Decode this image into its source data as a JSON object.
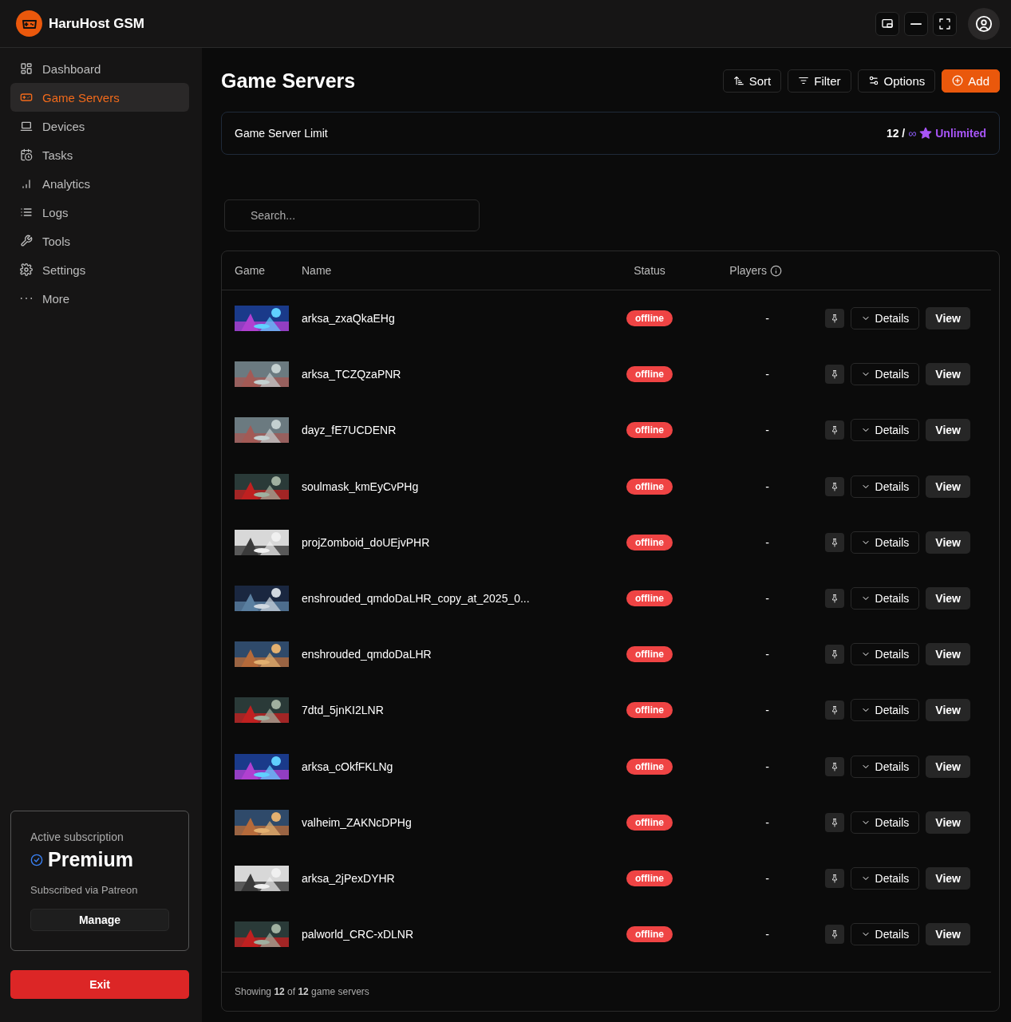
{
  "app": {
    "title": "HaruHost GSM"
  },
  "sidebar": {
    "items": [
      {
        "label": "Dashboard",
        "selected": false
      },
      {
        "label": "Game Servers",
        "selected": true
      },
      {
        "label": "Devices",
        "selected": false
      },
      {
        "label": "Tasks",
        "selected": false
      },
      {
        "label": "Analytics",
        "selected": false
      },
      {
        "label": "Logs",
        "selected": false
      },
      {
        "label": "Tools",
        "selected": false
      },
      {
        "label": "Settings",
        "selected": false
      },
      {
        "label": "More",
        "selected": false
      }
    ],
    "subscription": {
      "caption": "Active subscription",
      "plan": "Premium",
      "via": "Subscribed via Patreon",
      "button": "Manage"
    },
    "exit_button": "Exit"
  },
  "page": {
    "title": "Game Servers",
    "actions": [
      {
        "label": "Sort",
        "kind": "sort"
      },
      {
        "label": "Filter",
        "kind": "filter"
      },
      {
        "label": "Options",
        "kind": "options"
      },
      {
        "label": "Add",
        "kind": "add"
      }
    ]
  },
  "limit": {
    "label": "Game Server Limit",
    "count": "12 /",
    "max": "∞",
    "tier": "Unlimited"
  },
  "search": {
    "placeholder": "Search..."
  },
  "table": {
    "columns": [
      "Game",
      "Name",
      "Status",
      "Players"
    ],
    "rows": [
      {
        "name": "arksa_zxaQkaEHg",
        "status": "offline",
        "players": "-",
        "details": "Details",
        "view": "View"
      },
      {
        "name": "arksa_TCZQzaPNR",
        "status": "offline",
        "players": "-",
        "details": "Details",
        "view": "View"
      },
      {
        "name": "dayz_fE7UCDENR",
        "status": "offline",
        "players": "-",
        "details": "Details",
        "view": "View"
      },
      {
        "name": "soulmask_kmEyCvPHg",
        "status": "offline",
        "players": "-",
        "details": "Details",
        "view": "View"
      },
      {
        "name": "projZomboid_doUEjvPHR",
        "status": "offline",
        "players": "-",
        "details": "Details",
        "view": "View"
      },
      {
        "name": "enshrouded_qmdoDaLHR_copy_at_2025_0...",
        "status": "offline",
        "players": "-",
        "details": "Details",
        "view": "View"
      },
      {
        "name": "enshrouded_qmdoDaLHR",
        "status": "offline",
        "players": "-",
        "details": "Details",
        "view": "View"
      },
      {
        "name": "7dtd_5jnKI2LNR",
        "status": "offline",
        "players": "-",
        "details": "Details",
        "view": "View"
      },
      {
        "name": "arksa_cOkfFKLNg",
        "status": "offline",
        "players": "-",
        "details": "Details",
        "view": "View"
      },
      {
        "name": "valheim_ZAKNcDPHg",
        "status": "offline",
        "players": "-",
        "details": "Details",
        "view": "View"
      },
      {
        "name": "arksa_2jPexDYHR",
        "status": "offline",
        "players": "-",
        "details": "Details",
        "view": "View"
      },
      {
        "name": "palworld_CRC-xDLNR",
        "status": "offline",
        "players": "-",
        "details": "Details",
        "view": "View"
      }
    ],
    "footer": "Showing **12** of **12** game servers"
  }
}
